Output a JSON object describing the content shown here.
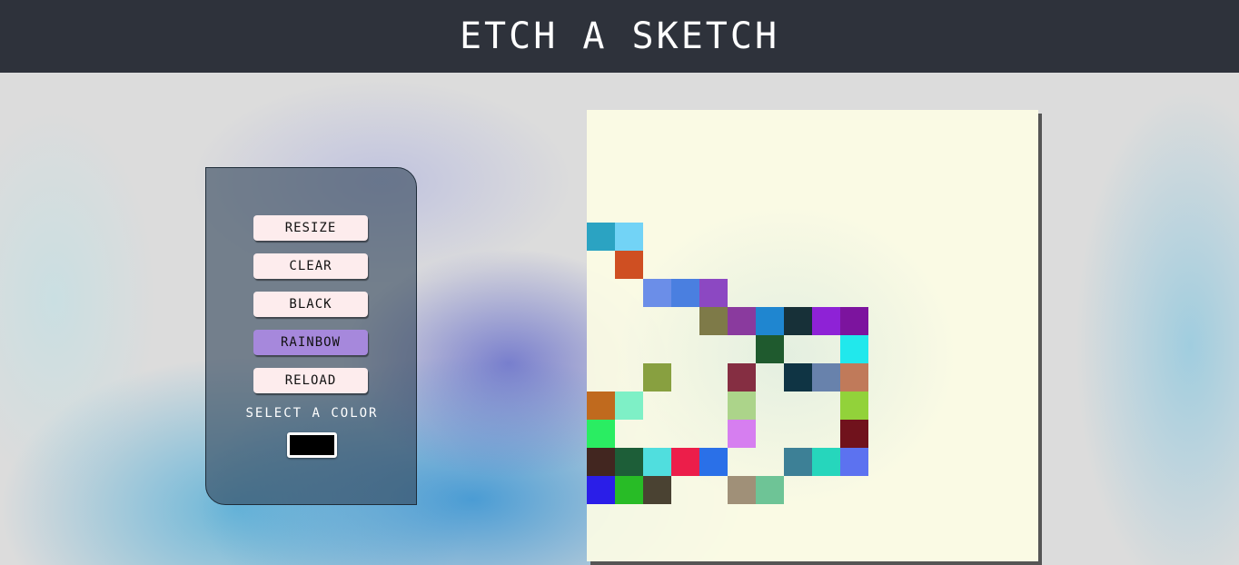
{
  "header": {
    "title": "Etch A Sketch"
  },
  "controls": {
    "resize_label": "Resize",
    "clear_label": "Clear",
    "black_label": "Black",
    "rainbow_label": "Rainbow",
    "reload_label": "Reload",
    "select_color_label": "Select a color",
    "selected_color": "#000000",
    "active_mode": "rainbow"
  },
  "colors": {
    "header_bg": "#2e323b",
    "button_bg": "#fdeced",
    "active_button_bg": "#a688dc",
    "board_bg": "#fcfce4"
  },
  "grid": {
    "columns": 16,
    "rows": 16,
    "painted_cells": [
      {
        "row": 4,
        "col": 0,
        "color": "#2ba3c2"
      },
      {
        "row": 4,
        "col": 1,
        "color": "#72d3f6"
      },
      {
        "row": 5,
        "col": 1,
        "color": "#cf4f22"
      },
      {
        "row": 6,
        "col": 2,
        "color": "#6b8ee8"
      },
      {
        "row": 6,
        "col": 3,
        "color": "#4a7fe0"
      },
      {
        "row": 6,
        "col": 4,
        "color": "#8c48c2"
      },
      {
        "row": 7,
        "col": 4,
        "color": "#7e7a48"
      },
      {
        "row": 7,
        "col": 5,
        "color": "#8a3a9e"
      },
      {
        "row": 7,
        "col": 6,
        "color": "#1f86d0"
      },
      {
        "row": 7,
        "col": 7,
        "color": "#173038"
      },
      {
        "row": 7,
        "col": 8,
        "color": "#8e22d6"
      },
      {
        "row": 7,
        "col": 9,
        "color": "#7c149e"
      },
      {
        "row": 8,
        "col": 6,
        "color": "#1f5a2e"
      },
      {
        "row": 8,
        "col": 9,
        "color": "#21e8ec"
      },
      {
        "row": 9,
        "col": 2,
        "color": "#88a040"
      },
      {
        "row": 9,
        "col": 5,
        "color": "#852e42"
      },
      {
        "row": 9,
        "col": 7,
        "color": "#0f3444"
      },
      {
        "row": 9,
        "col": 8,
        "color": "#6882ac"
      },
      {
        "row": 9,
        "col": 9,
        "color": "#c07a5a"
      },
      {
        "row": 10,
        "col": 0,
        "color": "#c06a1e"
      },
      {
        "row": 10,
        "col": 1,
        "color": "#7ef0c6"
      },
      {
        "row": 10,
        "col": 5,
        "color": "#acd48a"
      },
      {
        "row": 10,
        "col": 9,
        "color": "#92d23a"
      },
      {
        "row": 11,
        "col": 0,
        "color": "#2aed62"
      },
      {
        "row": 11,
        "col": 5,
        "color": "#d67ef0"
      },
      {
        "row": 11,
        "col": 9,
        "color": "#70121c"
      },
      {
        "row": 12,
        "col": 0,
        "color": "#422620"
      },
      {
        "row": 12,
        "col": 1,
        "color": "#1d5e38"
      },
      {
        "row": 12,
        "col": 2,
        "color": "#50dede"
      },
      {
        "row": 12,
        "col": 3,
        "color": "#ec1e4a"
      },
      {
        "row": 12,
        "col": 4,
        "color": "#2a70e8"
      },
      {
        "row": 12,
        "col": 7,
        "color": "#3d8096"
      },
      {
        "row": 12,
        "col": 8,
        "color": "#26d6bc"
      },
      {
        "row": 12,
        "col": 9,
        "color": "#5c72f0"
      },
      {
        "row": 13,
        "col": 0,
        "color": "#2a1ee8"
      },
      {
        "row": 13,
        "col": 1,
        "color": "#28bc26"
      },
      {
        "row": 13,
        "col": 2,
        "color": "#4a4232"
      },
      {
        "row": 13,
        "col": 5,
        "color": "#a09078"
      },
      {
        "row": 13,
        "col": 6,
        "color": "#6ec496"
      }
    ]
  }
}
